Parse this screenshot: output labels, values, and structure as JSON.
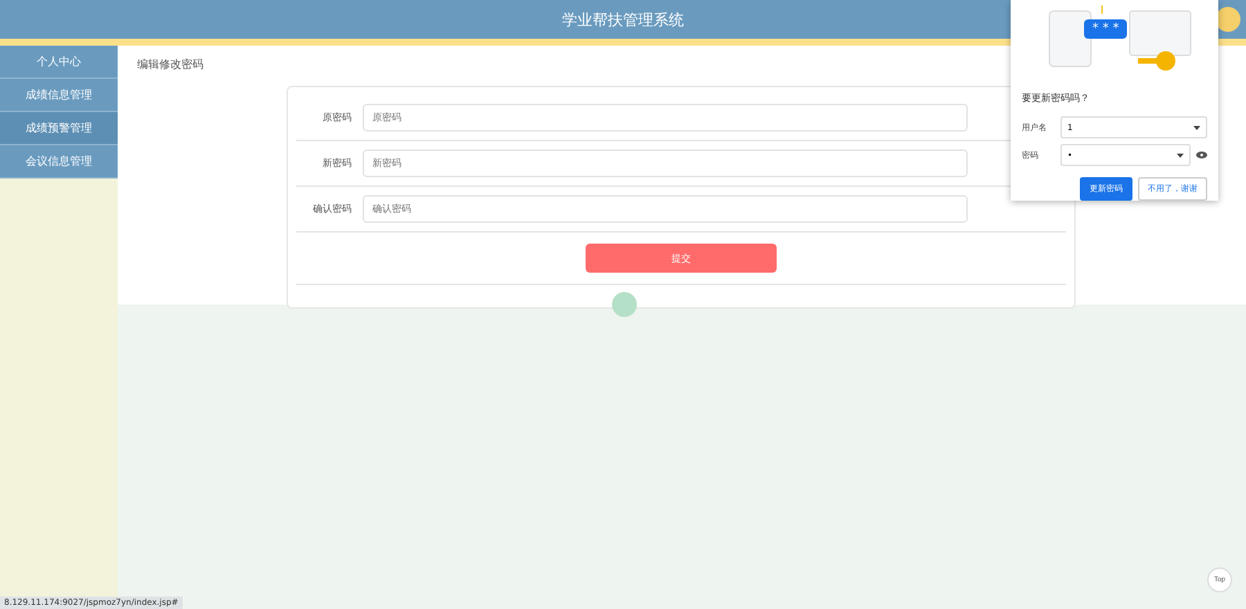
{
  "header": {
    "title": "学业帮扶管理系统"
  },
  "sidebar": {
    "items": [
      {
        "label": "个人中心",
        "selected": false
      },
      {
        "label": "成绩信息管理",
        "selected": false
      },
      {
        "label": "成绩预警管理",
        "selected": true
      },
      {
        "label": "会议信息管理",
        "selected": false
      }
    ]
  },
  "page": {
    "title": "编辑修改密码"
  },
  "form": {
    "fields": [
      {
        "label": "原密码",
        "placeholder": "原密码"
      },
      {
        "label": "新密码",
        "placeholder": "新密码"
      },
      {
        "label": "确认密码",
        "placeholder": "确认密码"
      }
    ],
    "submit": "提交"
  },
  "password_popup": {
    "badge": "* * *",
    "title": "要更新密码吗？",
    "username_label": "用户名",
    "username": "1",
    "password_label": "密码",
    "password": "•",
    "primary": "更新密码",
    "secondary": "不用了，谢谢"
  },
  "status_bar": {
    "url": "8.129.11.174:9027/jspmoz7yn/index.jsp#"
  },
  "top_button": "Top"
}
